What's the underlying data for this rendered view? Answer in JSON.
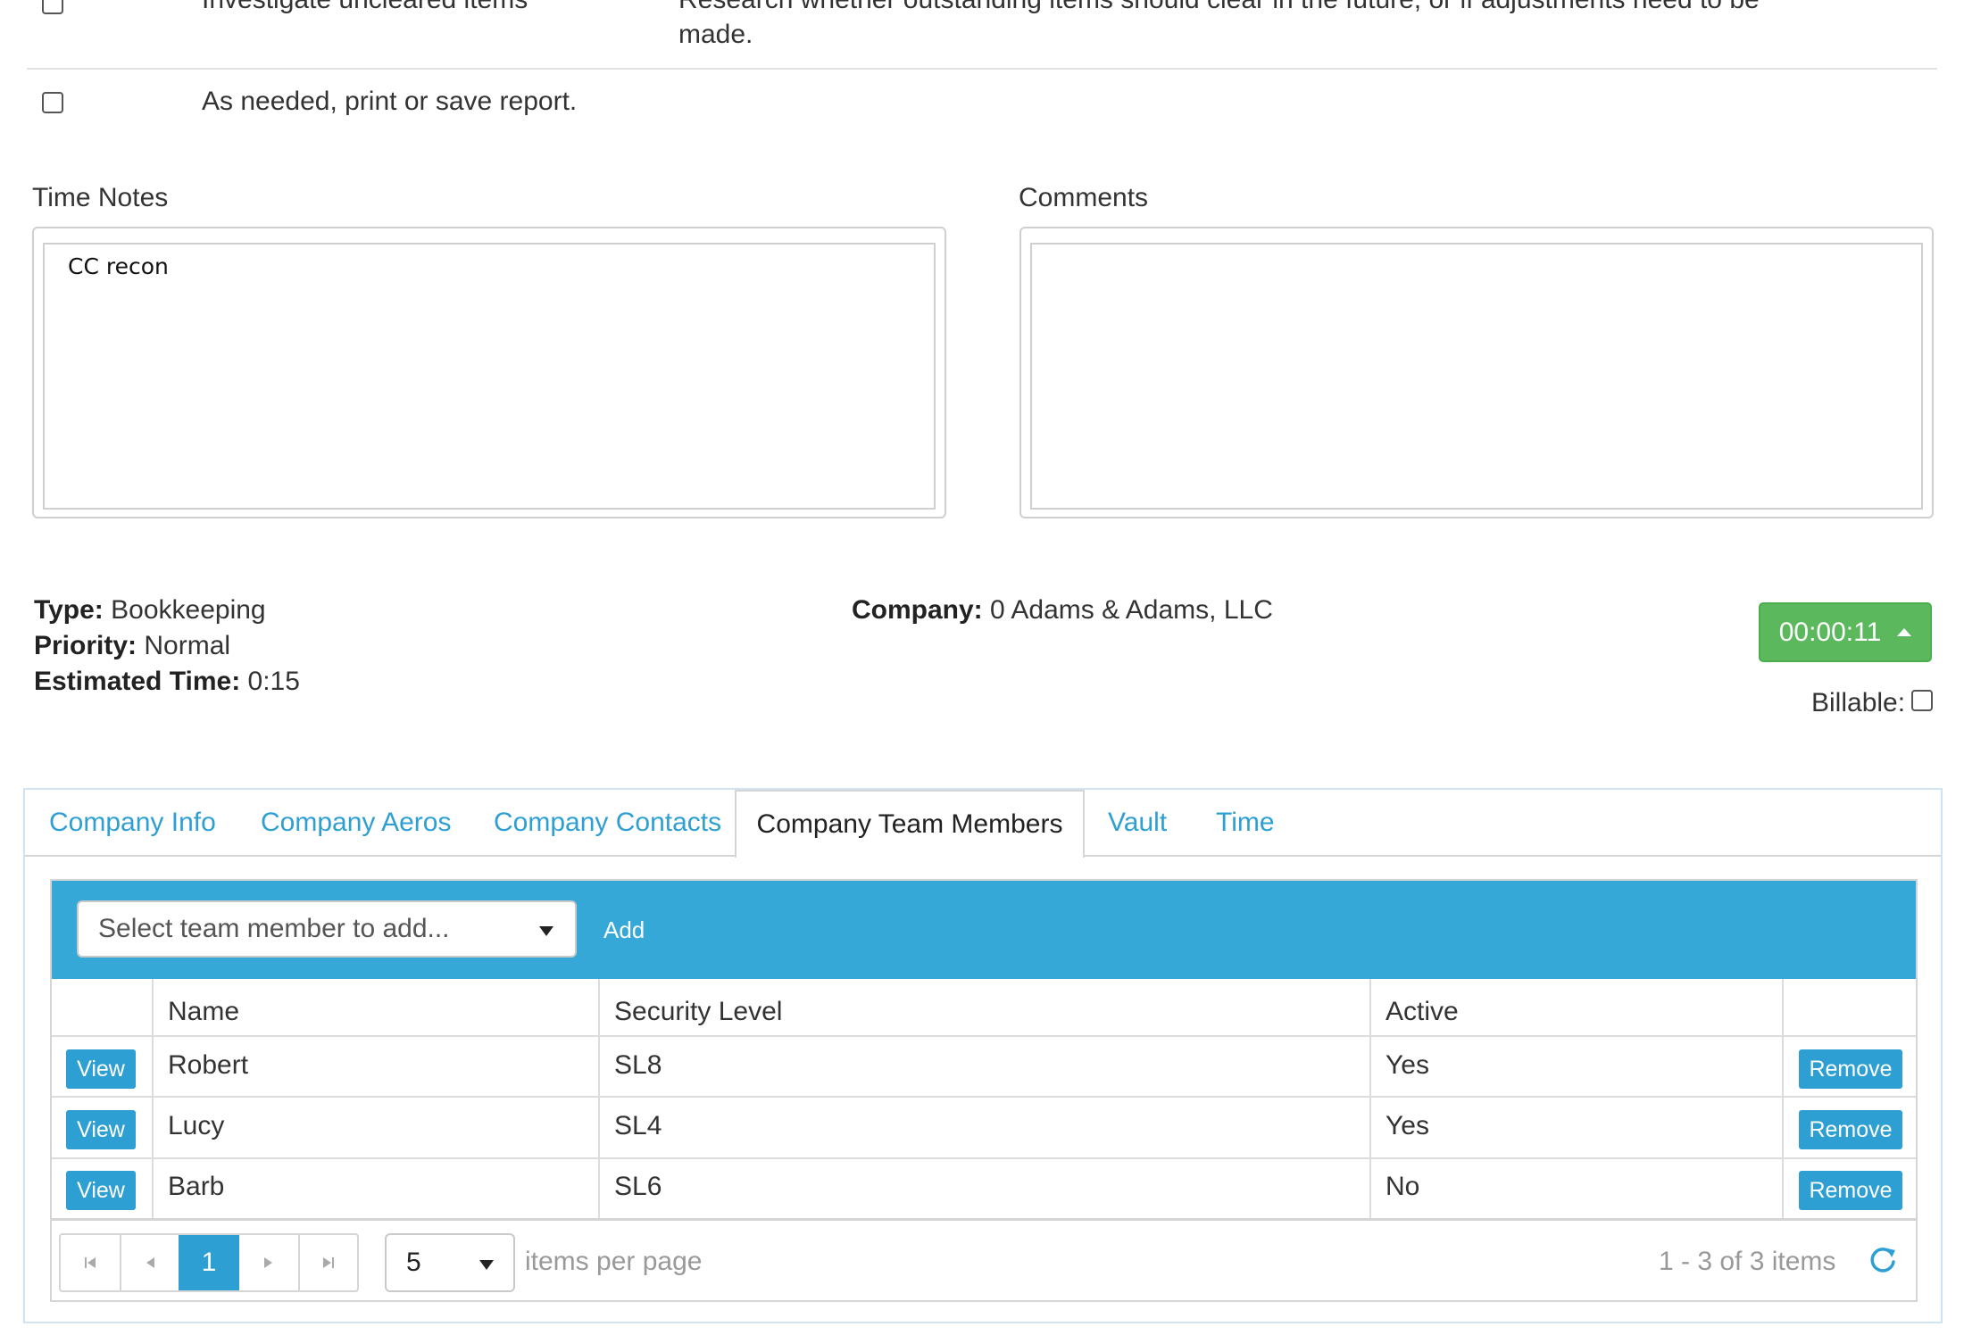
{
  "checklist": [
    {
      "label": "Investigate uncleared items",
      "description_line1": "Research whether outstanding items should clear in the future, or if adjustments need to be",
      "description_line2": "made."
    },
    {
      "label": "As needed, print or save report."
    }
  ],
  "time_notes": {
    "label": "Time Notes",
    "value": "CC recon"
  },
  "comments": {
    "label": "Comments",
    "value": ""
  },
  "info": {
    "type_label": "Type:",
    "type_value": "Bookkeeping",
    "priority_label": "Priority:",
    "priority_value": "Normal",
    "estimated_label": "Estimated Time:",
    "estimated_value": "0:15",
    "company_label": "Company:",
    "company_value": "0 Adams & Adams, LLC"
  },
  "timer": {
    "value": "00:00:11",
    "color": "#5cb85c"
  },
  "billable": {
    "label": "Billable:"
  },
  "tabs": [
    {
      "label": "Company Info"
    },
    {
      "label": "Company Aeros"
    },
    {
      "label": "Company Contacts"
    },
    {
      "label": "Company Team Members",
      "active": true
    },
    {
      "label": "Vault"
    },
    {
      "label": "Time"
    }
  ],
  "team": {
    "select_placeholder": "Select team member to add...",
    "add_label": "Add",
    "toolbar_color": "#36a8d8",
    "columns": [
      "Name",
      "Security Level",
      "Active"
    ],
    "view_label": "View",
    "remove_label": "Remove",
    "rows": [
      {
        "name": "Robert",
        "security": "SL8",
        "active": "Yes"
      },
      {
        "name": "Lucy",
        "security": "SL4",
        "active": "Yes"
      },
      {
        "name": "Barb",
        "security": "SL6",
        "active": "No"
      }
    ]
  },
  "pager": {
    "current_page": "1",
    "page_size": "5",
    "items_per_page_label": "items per page",
    "summary": "1 - 3 of 3 items"
  },
  "icons": [
    "first-page-icon",
    "prev-page-icon",
    "next-page-icon",
    "last-page-icon",
    "refresh-icon",
    "caret-down-icon",
    "caret-up-icon"
  ]
}
